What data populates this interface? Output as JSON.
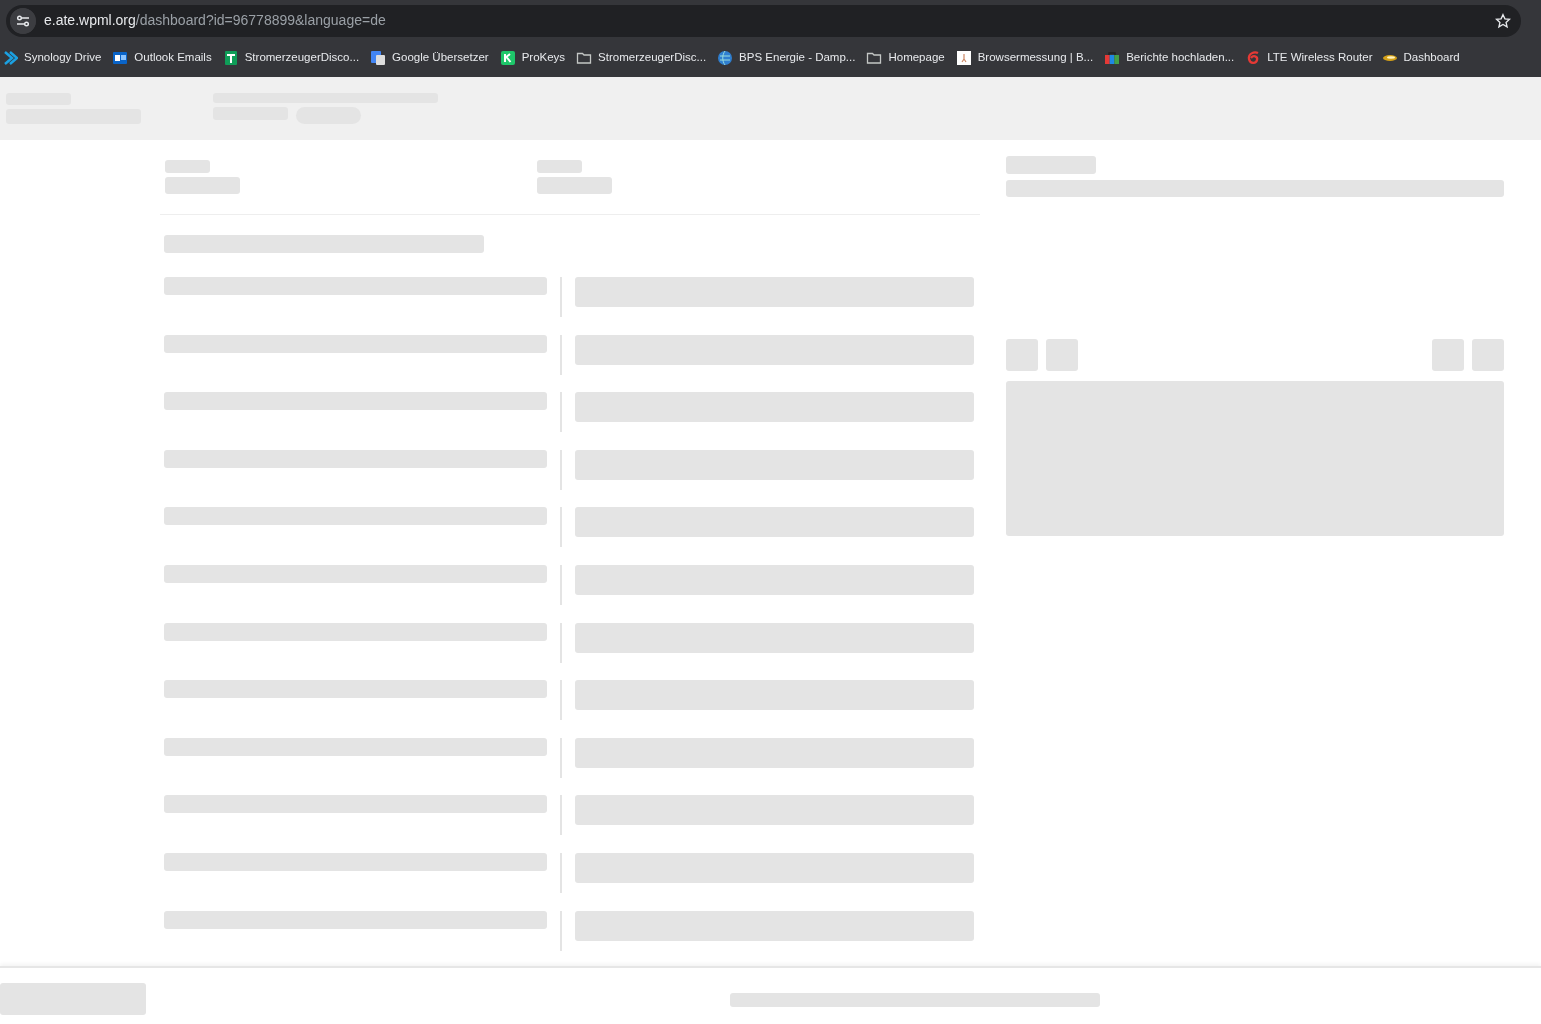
{
  "address_bar": {
    "host": "e.ate.wpml.org",
    "path": "/dashboard?id=96778899&language=de"
  },
  "bookmarks": [
    {
      "label": "Synology Drive",
      "kind": "synology"
    },
    {
      "label": "Outlook Emails",
      "kind": "outlook"
    },
    {
      "label": "StromerzeugerDisco...",
      "kind": "sheet"
    },
    {
      "label": "Google Übersetzer",
      "kind": "translate"
    },
    {
      "label": "ProKeys",
      "kind": "prokeys"
    },
    {
      "label": "StromerzeugerDisc...",
      "kind": "folder"
    },
    {
      "label": "BPS Energie - Damp...",
      "kind": "globe"
    },
    {
      "label": "Homepage",
      "kind": "folder"
    },
    {
      "label": "Browsermessung | B...",
      "kind": "page"
    },
    {
      "label": "Berichte hochladen...",
      "kind": "bag"
    },
    {
      "label": "LTE Wireless Router",
      "kind": "swirl"
    },
    {
      "label": "Dashboard",
      "kind": "lens"
    }
  ]
}
